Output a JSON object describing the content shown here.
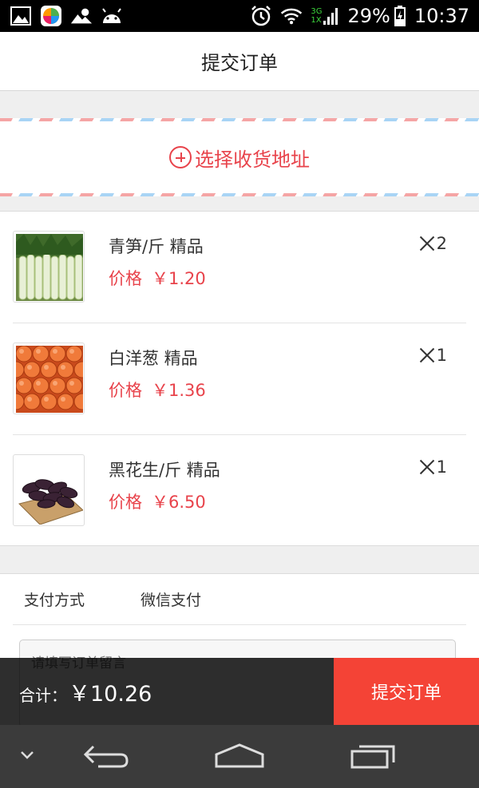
{
  "status_bar": {
    "network_top": "3G",
    "network_bottom": "1X",
    "battery": "29%",
    "time": "10:37"
  },
  "header": {
    "title": "提交订单"
  },
  "address": {
    "label": "选择收货地址"
  },
  "products": [
    {
      "name": "青笋/斤 精品",
      "price_label": "价格",
      "price": "￥1.20",
      "qty": "2"
    },
    {
      "name": "白洋葱 精品",
      "price_label": "价格",
      "price": "￥1.36",
      "qty": "1"
    },
    {
      "name": "黑花生/斤 精品",
      "price_label": "价格",
      "price": "￥6.50",
      "qty": "1"
    }
  ],
  "payment": {
    "label": "支付方式",
    "value": "微信支付"
  },
  "message": {
    "placeholder": "请填写订单留言"
  },
  "footer": {
    "total_label": "合计：",
    "total_value": "￥10.26",
    "submit_label": "提交订单"
  },
  "colors": {
    "accent_red": "#e8434b",
    "submit_red": "#f44336",
    "nav_bg": "#3b3b3b"
  }
}
